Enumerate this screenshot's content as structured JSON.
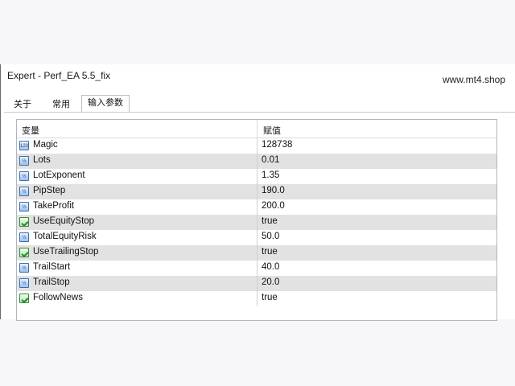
{
  "window": {
    "title": "Expert - Perf_EA 5.5_fix",
    "watermark": "www.mt4.shop"
  },
  "tabs": [
    {
      "label": "关于"
    },
    {
      "label": "常用"
    },
    {
      "label": "输入参数",
      "active": true
    }
  ],
  "table": {
    "headers": {
      "variable": "变量",
      "value": "赋值"
    },
    "rows": [
      {
        "icon": "int-param-icon",
        "name": "Magic",
        "value": "128738"
      },
      {
        "icon": "double-param-icon",
        "name": "Lots",
        "value": "0.01"
      },
      {
        "icon": "double-param-icon",
        "name": "LotExponent",
        "value": "1.35"
      },
      {
        "icon": "double-param-icon",
        "name": "PipStep",
        "value": "190.0"
      },
      {
        "icon": "double-param-icon",
        "name": "TakeProfit",
        "value": "200.0"
      },
      {
        "icon": "bool-param-icon",
        "name": "UseEquityStop",
        "value": "true"
      },
      {
        "icon": "double-param-icon",
        "name": "TotalEquityRisk",
        "value": "50.0"
      },
      {
        "icon": "bool-param-icon",
        "name": "UseTrailingStop",
        "value": "true"
      },
      {
        "icon": "double-param-icon",
        "name": "TrailStart",
        "value": "40.0"
      },
      {
        "icon": "double-param-icon",
        "name": "TrailStop",
        "value": "20.0"
      },
      {
        "icon": "bool-param-icon",
        "name": "FollowNews",
        "value": "true"
      }
    ]
  },
  "colors": {
    "row_alt": "#e2e2e2",
    "border": "#aeb6c2"
  }
}
